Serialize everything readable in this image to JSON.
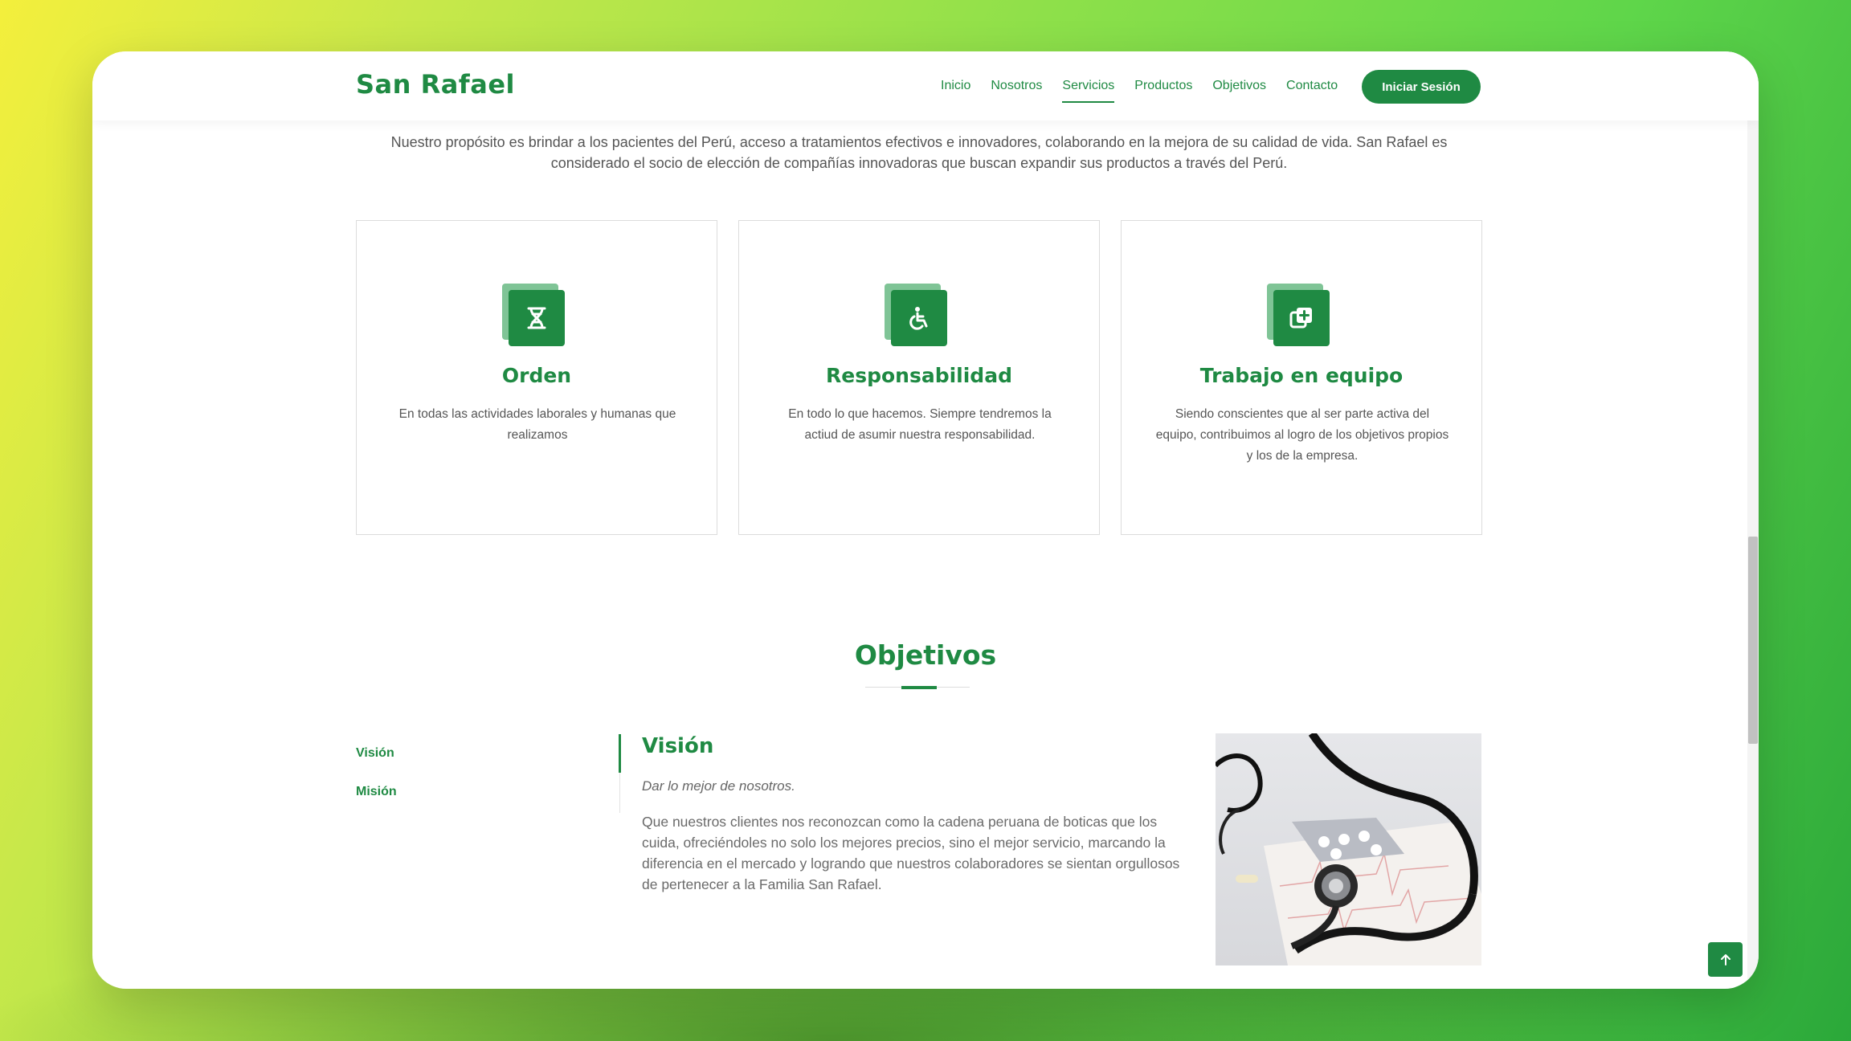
{
  "header": {
    "logo": "San Rafael",
    "nav": [
      "Inicio",
      "Nosotros",
      "Servicios",
      "Productos",
      "Objetivos",
      "Contacto"
    ],
    "active_nav": "Servicios",
    "login_label": "Iniciar Sesión"
  },
  "intro": "Nuestro propósito es brindar a los pacientes del Perú, acceso a tratamientos efectivos e innovadores, colaborando en la mejora de su calidad de vida. San Rafael es considerado el socio de elección de compañías innovadoras que buscan expandir sus productos a través del Perú.",
  "values": [
    {
      "title": "Orden",
      "text": "En todas las actividades laborales y humanas que realizamos",
      "icon": "dna-icon"
    },
    {
      "title": "Responsabilidad",
      "text": "En todo lo que hacemos. Siempre tendremos la actiud de asumir nuestra responsabilidad.",
      "icon": "wheelchair-icon"
    },
    {
      "title": "Trabajo en equipo",
      "text": "Siendo conscientes que al ser parte activa del equipo, contribuimos al logro de los objetivos propios y los de la empresa.",
      "icon": "plus-copy-icon"
    }
  ],
  "objetivos": {
    "title": "Objetivos",
    "tabs": [
      "Visión",
      "Misión"
    ],
    "active_tab": "Visión",
    "panel_title": "Visión",
    "panel_subtitle": "Dar lo mejor de nosotros.",
    "panel_text": "Que nuestros clientes nos reconozcan como la cadena peruana de boticas que los cuida, ofreciéndoles no solo los mejores precios, sino el mejor servicio, marcando la diferencia en el mercado y logrando que nuestros colaboradores se sientan orgullosos de pertenecer a la Familia San Rafael."
  },
  "colors": {
    "brand": "#1f8a43",
    "brand_light": "#7fc496",
    "text": "#555555"
  }
}
